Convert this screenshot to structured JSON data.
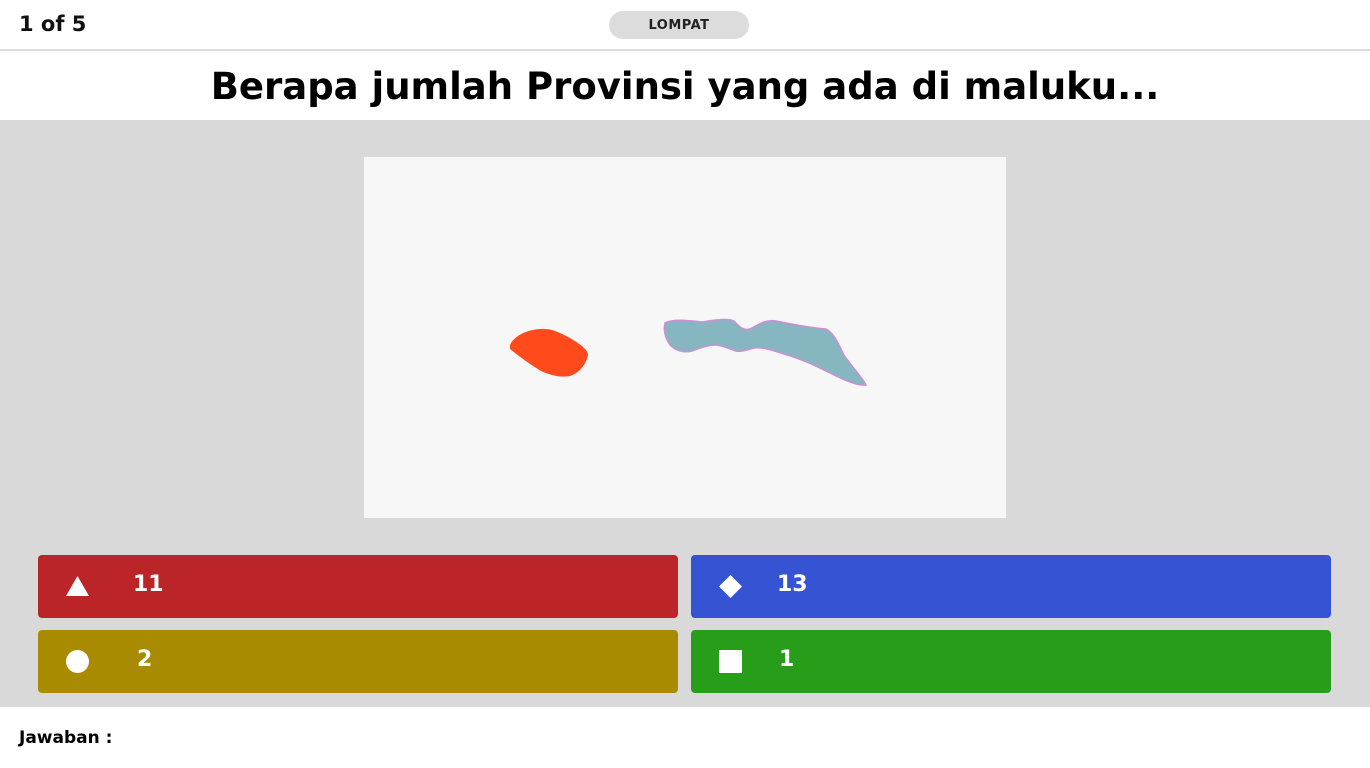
{
  "header": {
    "counter": "1 of 5",
    "skip_label": "LOMPAT"
  },
  "question": {
    "text": "Berapa jumlah Provinsi yang ada di maluku..."
  },
  "image": {
    "description_icon": "maluku-islands-map",
    "colors": {
      "left_island": "#ff4a1c",
      "right_island": "#86b6bf",
      "right_outline": "#cc8fd6",
      "background": "#f7f7f7"
    }
  },
  "answers": [
    {
      "shape": "triangle",
      "label": "11",
      "color": "#bb2527"
    },
    {
      "shape": "diamond",
      "label": "13",
      "color": "#3653d3"
    },
    {
      "shape": "circle",
      "label": "2",
      "color": "#a88b01"
    },
    {
      "shape": "square",
      "label": "1",
      "color": "#289d1a"
    }
  ],
  "footer": {
    "answer_label": "Jawaban :"
  }
}
